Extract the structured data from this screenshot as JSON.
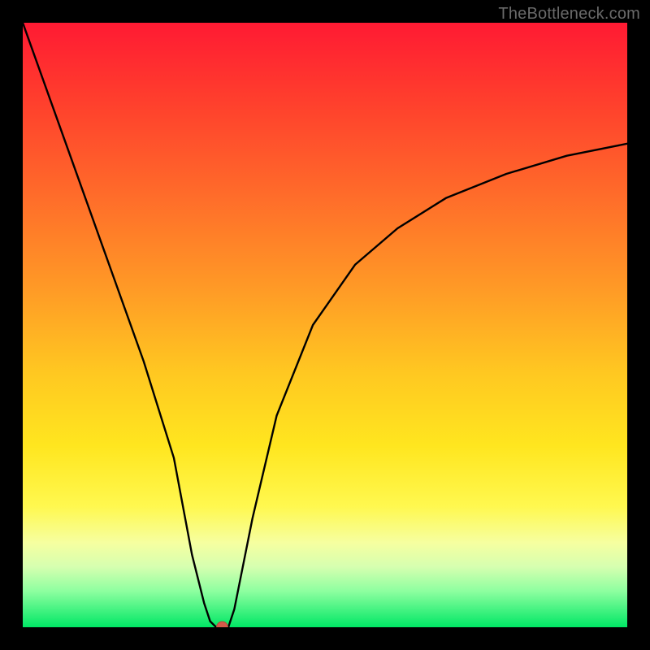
{
  "watermark": "TheBottleneck.com",
  "chart_data": {
    "type": "line",
    "title": "",
    "xlabel": "",
    "ylabel": "",
    "xlim": [
      0,
      100
    ],
    "ylim": [
      0,
      100
    ],
    "legend": false,
    "grid": false,
    "series": [
      {
        "name": "bottleneck-curve",
        "x": [
          0,
          5,
          10,
          15,
          20,
          25,
          28,
          30,
          31,
          32,
          33,
          34,
          35,
          38,
          42,
          48,
          55,
          62,
          70,
          80,
          90,
          100
        ],
        "values": [
          100,
          86,
          72,
          58,
          44,
          28,
          12,
          4,
          1,
          0,
          0,
          0,
          3,
          18,
          35,
          50,
          60,
          66,
          71,
          75,
          78,
          80
        ]
      }
    ],
    "marker": {
      "x": 33,
      "y": 0,
      "color": "#d55a4a"
    },
    "background_gradient": {
      "stops": [
        {
          "pos": 0.0,
          "color": "#ff1a33"
        },
        {
          "pos": 0.12,
          "color": "#ff3c2d"
        },
        {
          "pos": 0.28,
          "color": "#ff6a2a"
        },
        {
          "pos": 0.44,
          "color": "#ff9a26"
        },
        {
          "pos": 0.58,
          "color": "#ffc821"
        },
        {
          "pos": 0.7,
          "color": "#ffe61f"
        },
        {
          "pos": 0.8,
          "color": "#fff84f"
        },
        {
          "pos": 0.86,
          "color": "#f6ffa0"
        },
        {
          "pos": 0.9,
          "color": "#d6ffb0"
        },
        {
          "pos": 0.94,
          "color": "#8effa0"
        },
        {
          "pos": 1.0,
          "color": "#00e765"
        }
      ]
    }
  }
}
